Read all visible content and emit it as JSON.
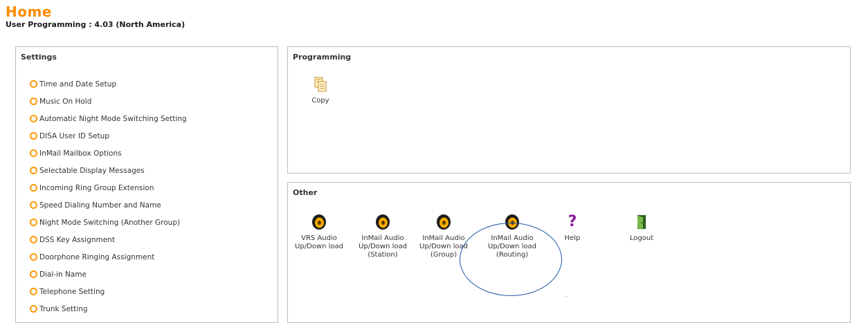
{
  "page": {
    "title": "Home",
    "subtitle": "User Programming : 4.03 (North America)"
  },
  "settings": {
    "title": "Settings",
    "items": [
      {
        "label": "Time and Date Setup"
      },
      {
        "label": "Music On Hold"
      },
      {
        "label": "Automatic Night Mode Switching Setting"
      },
      {
        "label": "DISA User ID Setup"
      },
      {
        "label": "InMail Mailbox Options"
      },
      {
        "label": "Selectable Display Messages"
      },
      {
        "label": "Incoming Ring Group Extension"
      },
      {
        "label": "Speed Dialing Number and Name"
      },
      {
        "label": "Night Mode Switching (Another Group)"
      },
      {
        "label": "DSS Key Assignment"
      },
      {
        "label": "Doorphone Ringing Assignment"
      },
      {
        "label": "Dial-in Name"
      },
      {
        "label": "Telephone Setting"
      },
      {
        "label": "Trunk Setting"
      }
    ]
  },
  "programming": {
    "title": "Programming",
    "copy_label": "Copy"
  },
  "other": {
    "title": "Other",
    "vrs_label": "VRS Audio\nUp/Down load",
    "inmail_station_label": "InMail Audio\nUp/Down load\n(Station)",
    "inmail_group_label": "InMail Audio\nUp/Down load\n(Group)",
    "inmail_routing_label": "InMail Audio\nUp/Down load\n(Routing)",
    "help_label": "Help",
    "help_glyph": "?",
    "logout_label": "Logout"
  },
  "colors": {
    "title": "#ff8c00",
    "bullet": "#ff9900",
    "highlight_circle": "#1f5aa6",
    "help_icon": "#8a1a9a"
  }
}
